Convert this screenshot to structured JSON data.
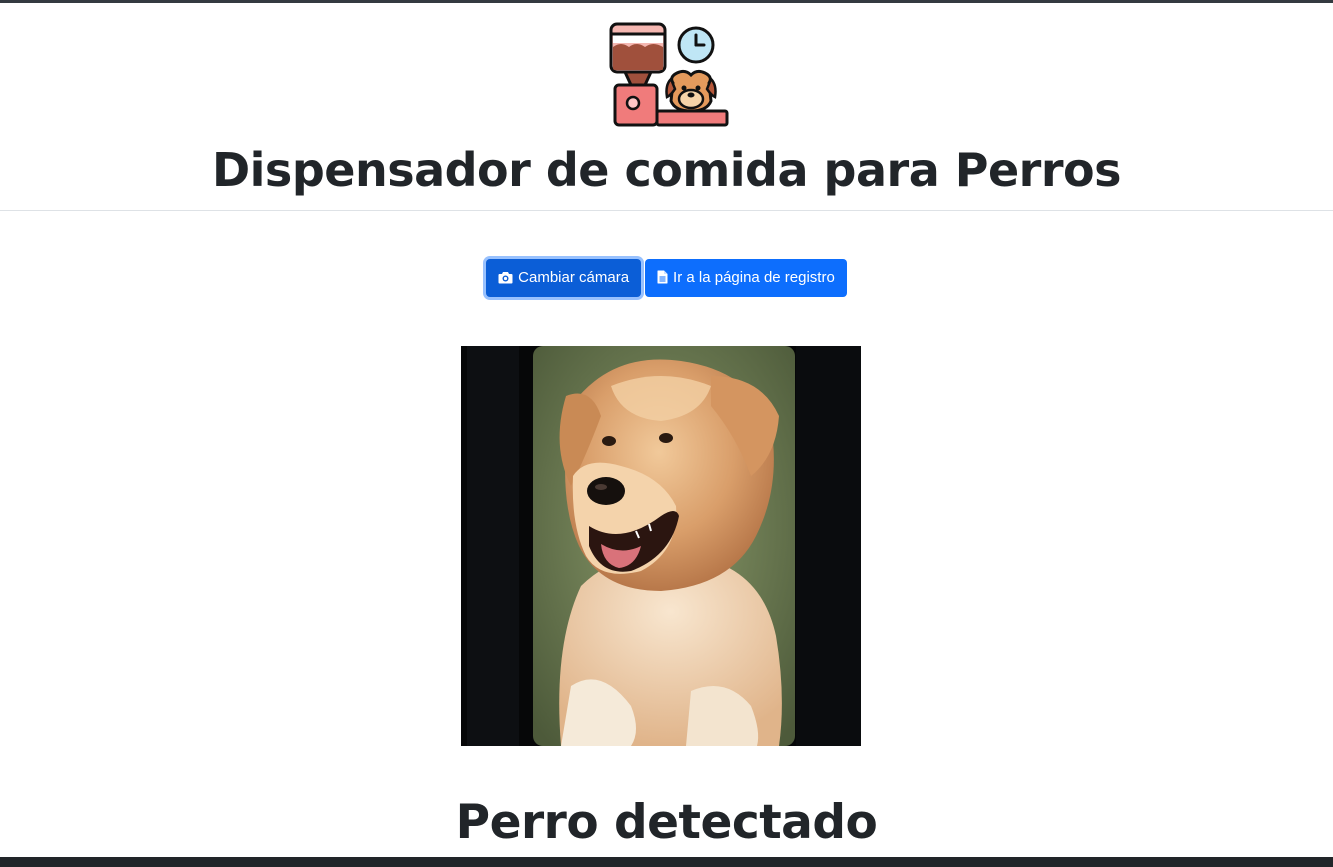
{
  "header": {
    "logo_icon": "dog-food-dispenser-clock-icon",
    "title": "Dispensador de comida para Perros"
  },
  "toolbar": {
    "switch_camera_label": "Cambiar cámara",
    "switch_camera_icon": "camera-icon",
    "registry_label": "Ir a la página de registro",
    "registry_icon": "file-icon"
  },
  "camera": {
    "feed_content": "golden-retriever-photo-on-phone-screen"
  },
  "status": {
    "text": "Perro detectado"
  },
  "colors": {
    "primary": "#0d6efd",
    "primary_active": "#0b5ed7",
    "text": "#212529",
    "footer": "#212529"
  }
}
